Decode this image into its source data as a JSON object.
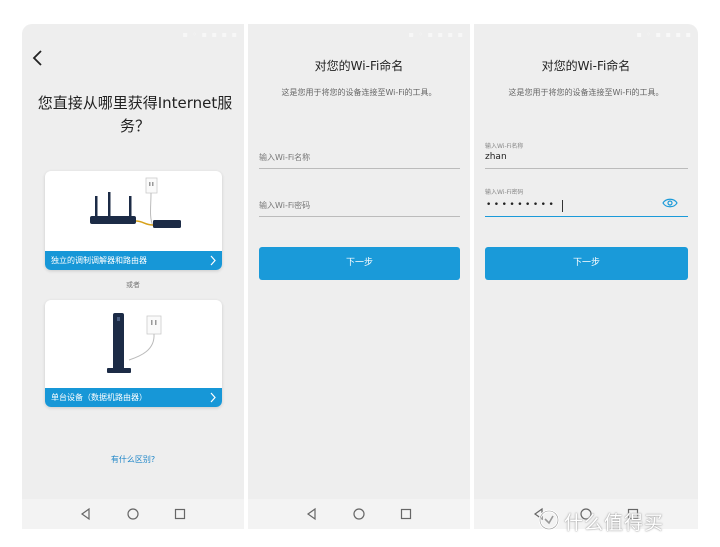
{
  "screen1": {
    "title": "您直接从哪里获得Internet服务？",
    "card1_label": "独立的调制调解器和路由器",
    "or_text": "或者",
    "card2_label": "单台设备（数据机路由器）",
    "diff_link": "有什么区别?"
  },
  "screen2": {
    "title": "对您的Wi-Fi命名",
    "subtitle": "这是您用于将您的设备连接至Wi-Fi的工具。",
    "name_placeholder": "输入Wi-Fi名称",
    "password_placeholder": "输入Wi-Fi密码",
    "next_label": "下一步"
  },
  "screen3": {
    "title": "对您的Wi-Fi命名",
    "subtitle": "这是您用于将您的设备连接至Wi-Fi的工具。",
    "name_label": "输入Wi-Fi名称",
    "name_value": "zhan",
    "password_label": "输入Wi-Fi密码",
    "password_masked": "•••••••••",
    "next_label": "下一步"
  },
  "watermark": "什么值得买",
  "colors": {
    "accent": "#1a9ad9",
    "link": "#1f86c8",
    "screen_bg": "#eeeeee",
    "device": "#1c2b46"
  },
  "icons": {
    "back": "back-arrow-icon",
    "card_chevron": "chevron-right-icon",
    "show_password": "eye-icon",
    "nav": [
      "nav-back-icon",
      "nav-home-icon",
      "nav-recent-icon"
    ]
  }
}
